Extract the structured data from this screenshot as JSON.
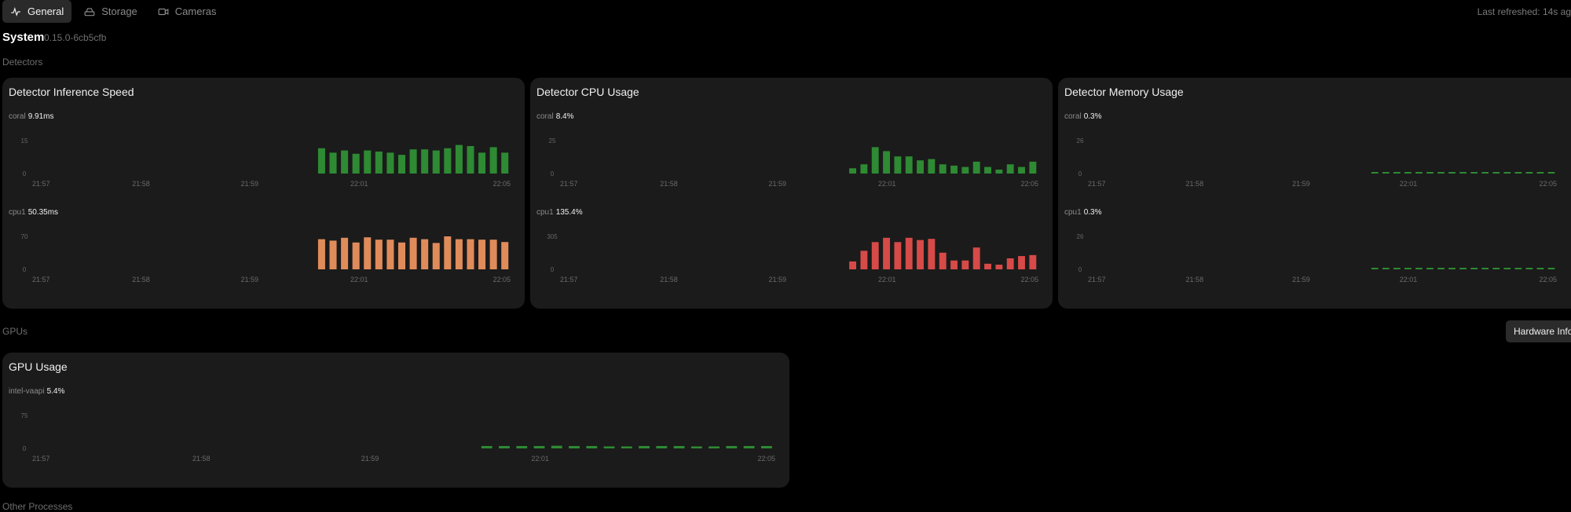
{
  "tabs": [
    {
      "label": "General",
      "icon": "activity-icon",
      "active": true
    },
    {
      "label": "Storage",
      "icon": "hard-drive-icon",
      "active": false
    },
    {
      "label": "Cameras",
      "icon": "video-camera-icon",
      "active": false
    }
  ],
  "last_refreshed": "Last refreshed: 14s ag",
  "system": {
    "title": "System",
    "version": "0.15.0-6cb5cfb"
  },
  "sections": {
    "detectors": "Detectors",
    "gpus": "GPUs",
    "other": "Other Processes"
  },
  "hardware_button": "Hardware Info",
  "cards": [
    {
      "title": "Detector Inference Speed",
      "metrics": [
        {
          "name": "coral",
          "value": "9.91ms"
        },
        {
          "name": "cpu1",
          "value": "50.35ms"
        }
      ]
    },
    {
      "title": "Detector CPU Usage",
      "metrics": [
        {
          "name": "coral",
          "value": "8.4%"
        },
        {
          "name": "cpu1",
          "value": "135.4%"
        }
      ]
    },
    {
      "title": "Detector Memory Usage",
      "metrics": [
        {
          "name": "coral",
          "value": "0.3%"
        },
        {
          "name": "cpu1",
          "value": "0.3%"
        }
      ]
    },
    {
      "title": "GPU Usage",
      "metrics": [
        {
          "name": "intel-vaapi",
          "value": "5.4%"
        }
      ]
    }
  ],
  "chart_data": [
    {
      "type": "bar",
      "title": "coral",
      "color": "#2e8a33",
      "x": [
        "21:57",
        "21:58",
        "21:59",
        "22:01",
        "22:05"
      ],
      "ylim": [
        0,
        15
      ],
      "yticks": [
        0,
        15
      ],
      "start_fraction": 0.593,
      "values": [
        11.5,
        9.5,
        10.5,
        9,
        10.5,
        10,
        9.5,
        8.5,
        11,
        11,
        10.5,
        11.5,
        13,
        12.5,
        9.5,
        12,
        9.5
      ]
    },
    {
      "type": "bar",
      "title": "cpu1",
      "color": "#e08b5a",
      "x": [
        "21:57",
        "21:58",
        "21:59",
        "22:01",
        "22:05"
      ],
      "ylim": [
        0,
        70
      ],
      "yticks": [
        0,
        70
      ],
      "start_fraction": 0.593,
      "values": [
        64,
        61,
        67,
        57,
        68,
        63,
        63,
        57,
        67,
        64,
        56,
        70,
        64,
        64,
        63,
        63,
        58
      ]
    },
    {
      "type": "bar",
      "title": "coral",
      "color": "#2e8a33",
      "x": [
        "21:57",
        "21:58",
        "21:59",
        "22:01",
        "22:05"
      ],
      "ylim": [
        0,
        25
      ],
      "yticks": [
        0,
        25
      ],
      "start_fraction": 0.6,
      "values": [
        4,
        7,
        20,
        17,
        13,
        13,
        10,
        11,
        7,
        6,
        5,
        9,
        5,
        3,
        7,
        5,
        9
      ]
    },
    {
      "type": "bar",
      "title": "cpu1",
      "color": "#d64a48",
      "x": [
        "21:57",
        "21:58",
        "21:59",
        "22:01",
        "22:05"
      ],
      "ylim": [
        0,
        305
      ],
      "yticks": [
        0,
        305
      ],
      "start_fraction": 0.6,
      "values": [
        73,
        172,
        252,
        292,
        252,
        292,
        271,
        282,
        154,
        82,
        82,
        202,
        52,
        43,
        102,
        123,
        132
      ]
    },
    {
      "type": "bar",
      "title": "coral",
      "color": "#2e8a33",
      "x": [
        "21:57",
        "21:58",
        "21:59",
        "22:01",
        "22:05"
      ],
      "ylim": [
        0,
        26
      ],
      "yticks": [
        0,
        26
      ],
      "start_fraction": 0.6,
      "values": [
        0.3,
        0.3,
        0.3,
        0.3,
        0.3,
        0.3,
        0.3,
        0.3,
        0.3,
        0.3,
        0.3,
        0.3,
        0.3,
        0.3,
        0.3,
        0.3,
        0.3
      ]
    },
    {
      "type": "bar",
      "title": "cpu1",
      "color": "#2e8a33",
      "x": [
        "21:57",
        "21:58",
        "21:59",
        "22:01",
        "22:05"
      ],
      "ylim": [
        0,
        26
      ],
      "yticks": [
        0,
        26
      ],
      "start_fraction": 0.6,
      "values": [
        0.3,
        0.3,
        0.3,
        0.3,
        0.3,
        0.3,
        0.3,
        0.3,
        0.3,
        0.3,
        0.3,
        0.3,
        0.3,
        0.3,
        0.3,
        0.3,
        0.3
      ]
    },
    {
      "type": "bar",
      "title": "intel-vaapi",
      "color": "#2e8a33",
      "x": [
        "21:57",
        "21:58",
        "21:59",
        "22:01",
        "22:05"
      ],
      "ylim": [
        0,
        75
      ],
      "yticks": [
        0,
        75
      ],
      "start_fraction": 0.6,
      "values": [
        5.4,
        5.4,
        5.4,
        5.4,
        6,
        5.4,
        5.4,
        4.5,
        4.5,
        5.4,
        5.4,
        5.4,
        4.5,
        4.5,
        5.4,
        5.4,
        5.4
      ]
    }
  ]
}
